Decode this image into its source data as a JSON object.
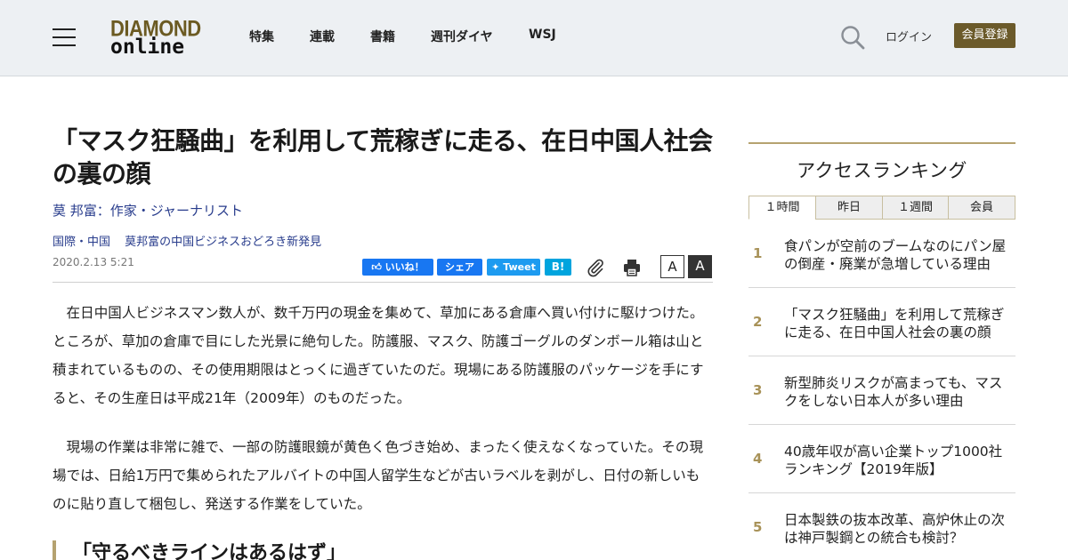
{
  "header": {
    "logo_top": "DIAMOND",
    "logo_bottom": "online",
    "nav": [
      "特集",
      "連載",
      "書籍",
      "週刊ダイヤ",
      "WSJ"
    ],
    "login": "ログイン",
    "register": "会員登録",
    "icons": [
      "hamburger-menu-icon",
      "search-icon"
    ],
    "colors": {
      "brand": "#6b5a2a",
      "header_bg": "#edf0f3"
    }
  },
  "article": {
    "title": "「マスク狂騒曲」を利用して荒稼ぎに走る、在日中国人社会の裏の顔",
    "author": "莫 邦富：作家・ジャーナリスト",
    "categories": [
      "国際・中国",
      "莫邦富の中国ビジネスおどろき新発見"
    ],
    "date": "2020.2.13 5:21",
    "share": {
      "like": "いいね！",
      "share": "シェア",
      "tweet": "Tweet",
      "hatena": "B!"
    },
    "font_small": "A",
    "font_large": "A",
    "paragraphs": [
      "在日中国人ビジネスマン数人が、数千万円の現金を集めて、草加にある倉庫へ買い付けに駆けつけた。ところが、草加の倉庫で目にした光景に絶句した。防護服、マスク、防護ゴーグルのダンボール箱は山と積まれているものの、その使用期限はとっくに過ぎていたのだ。現場にある防護服のパッケージを手にすると、その生産日は平成21年（2009年）のものだった。",
      "現場の作業は非常に雑で、一部の防護眼鏡が黄色く色づき始め、まったく使えなくなっていた。その現場では、日給1万円で集められたアルバイトの中国人留学生などが古いラベルを剥がし、日付の新しいものに貼り直して梱包し、発送する作業をしていた。"
    ],
    "subheading": "「守るべきラインはあるはず」"
  },
  "sidebar": {
    "title": "アクセスランキング",
    "tabs": [
      "１時間",
      "昨日",
      "１週間",
      "会員"
    ],
    "active_tab": "１時間",
    "ranking": [
      {
        "rank": "1",
        "title": "食パンが空前のブームなのにパン屋の倒産・廃業が急増している理由"
      },
      {
        "rank": "2",
        "title": "「マスク狂騒曲」を利用して荒稼ぎに走る、在日中国人社会の裏の顔"
      },
      {
        "rank": "3",
        "title": "新型肺炎リスクが高まっても、マスクをしない日本人が多い理由"
      },
      {
        "rank": "4",
        "title": "40歳年収が高い企業トップ1000社ランキング【2019年版】"
      },
      {
        "rank": "5",
        "title": "日本製鉄の抜本改革、高炉休止の次は神戸製鋼との統合も検討？"
      }
    ]
  }
}
